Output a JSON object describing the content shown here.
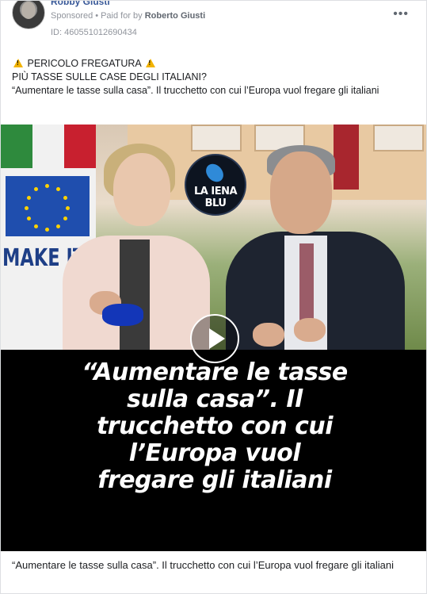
{
  "header": {
    "page_name": "Robby Giusti",
    "sponsored_label": "Sponsored",
    "separator": "•",
    "paid_for_prefix": "Paid for by",
    "paid_for_name": "Roberto Giusti",
    "ad_id": "ID: 460551012690434",
    "more_label": "•••"
  },
  "post": {
    "line1": "PERICOLO FREGATURA",
    "line2": "PIÙ TASSE SULLE CASE DEGLI ITALIANI?",
    "line3": "“Aumentare le tasse sulla casa”. Il trucchetto con cui l’Europa vuol fregare gli italiani"
  },
  "media": {
    "logo_text": "LA IENA BLU",
    "headline": "“Aumentare le tasse sulla casa”. Il trucchetto con cui l’Europa vuol fregare gli italiani",
    "banner_text": "MAKE IT REAL"
  },
  "caption": "“Aumentare le tasse sulla casa”. Il trucchetto con cui l’Europa vuol fregare gli italiani",
  "colors": {
    "link": "#385898",
    "meta": "#90949c",
    "warning": "#f2b300"
  }
}
